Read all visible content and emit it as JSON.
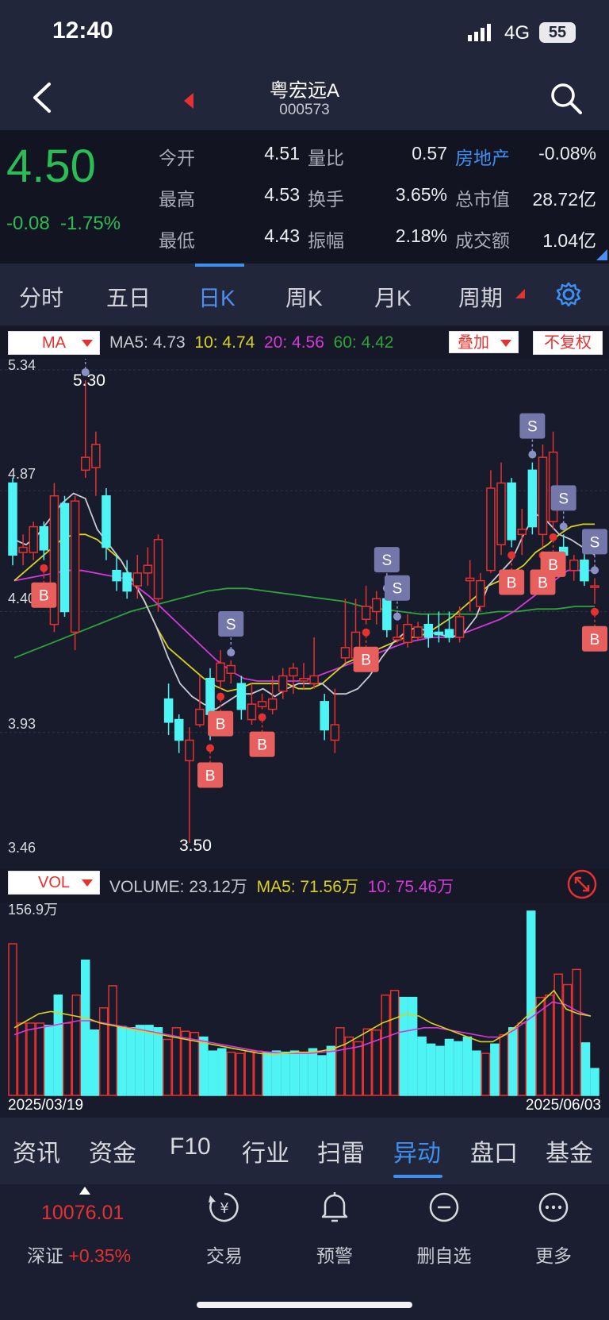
{
  "status": {
    "time": "12:40",
    "network": "4G",
    "battery": "55"
  },
  "header": {
    "title": "粤宏远A",
    "code": "000573"
  },
  "quote": {
    "price": "4.50",
    "change": "-0.08",
    "change_pct": "-1.75%",
    "rows": [
      [
        "今开",
        "4.51",
        "量比",
        "0.57",
        "房地产",
        "-0.08%"
      ],
      [
        "最高",
        "4.53",
        "换手",
        "3.65%",
        "总市值",
        "28.72亿"
      ],
      [
        "最低",
        "4.43",
        "振幅",
        "2.18%",
        "成交额",
        "1.04亿"
      ]
    ]
  },
  "tabs": [
    "分时",
    "五日",
    "日K",
    "周K",
    "月K",
    "周期"
  ],
  "kline": {
    "indicator": "MA",
    "ma_legend": {
      "ma5": "MA5: 4.73",
      "ma10": "10: 4.74",
      "ma20": "20: 4.56",
      "ma60": "60: 4.42"
    },
    "overlay_btn": "叠加",
    "adjust_btn": "不复权",
    "y_labels": [
      "5.34",
      "4.87",
      "4.40",
      "3.93",
      "3.46"
    ],
    "high_label": "5.30",
    "low_label": "3.50",
    "volume_indicator": "VOL",
    "vol_legend": {
      "volume": "VOLUME: 23.12万",
      "ma5": "MA5: 71.56万",
      "ma10": "10: 75.46万"
    },
    "vol_max_label": "156.9万",
    "date_start": "2025/03/19",
    "date_end": "2025/06/03",
    "signal_b": "B",
    "signal_s": "S"
  },
  "bottom_tabs": [
    "资讯",
    "资金",
    "F10",
    "行业",
    "扫雷",
    "异动",
    "盘口",
    "基金"
  ],
  "nav": {
    "index_value": "10076.01",
    "index_name": "深证",
    "index_change": "+0.35%",
    "items": [
      "交易",
      "预警",
      "删自选",
      "更多"
    ]
  },
  "colors": {
    "up": "#e5312f",
    "down": "#4ef4f4",
    "ma5": "#c9c9d2",
    "ma10": "#d7d21f",
    "ma20": "#d43ad8",
    "ma60": "#2fa23a",
    "accent": "#3e8ff0",
    "green": "#2bbd55"
  },
  "chart_data": {
    "type": "candlestick",
    "y_range": [
      3.46,
      5.34
    ],
    "high": 5.3,
    "low": 3.5,
    "candles": [
      {
        "o": 4.9,
        "c": 4.62,
        "h": 4.92,
        "l": 4.58
      },
      {
        "o": 4.63,
        "c": 4.65,
        "h": 4.7,
        "l": 4.58
      },
      {
        "o": 4.63,
        "c": 4.73,
        "h": 4.75,
        "l": 4.6
      },
      {
        "o": 4.73,
        "c": 4.64,
        "h": 4.75,
        "l": 4.6
      },
      {
        "o": 4.35,
        "c": 4.85,
        "h": 4.9,
        "l": 4.32
      },
      {
        "o": 4.82,
        "c": 4.4,
        "h": 4.85,
        "l": 4.38
      },
      {
        "o": 4.32,
        "c": 4.83,
        "h": 4.85,
        "l": 4.25
      },
      {
        "o": 4.95,
        "c": 5.0,
        "h": 5.3,
        "l": 4.92
      },
      {
        "o": 4.96,
        "c": 5.05,
        "h": 5.1,
        "l": 4.85
      },
      {
        "o": 4.85,
        "c": 4.65,
        "h": 4.88,
        "l": 4.6
      },
      {
        "o": 4.56,
        "c": 4.52,
        "h": 4.62,
        "l": 4.48
      },
      {
        "o": 4.55,
        "c": 4.48,
        "h": 4.6,
        "l": 4.45
      },
      {
        "o": 4.5,
        "c": 4.55,
        "h": 4.62,
        "l": 4.45
      },
      {
        "o": 4.55,
        "c": 4.58,
        "h": 4.65,
        "l": 4.5
      },
      {
        "o": 4.45,
        "c": 4.68,
        "h": 4.7,
        "l": 4.4
      },
      {
        "o": 4.06,
        "c": 3.97,
        "h": 4.12,
        "l": 3.92
      },
      {
        "o": 3.98,
        "c": 3.9,
        "h": 4.0,
        "l": 3.85
      },
      {
        "o": 3.82,
        "c": 3.9,
        "h": 3.95,
        "l": 3.5
      },
      {
        "o": 3.96,
        "c": 4.02,
        "h": 4.15,
        "l": 3.95
      },
      {
        "o": 4.14,
        "c": 4.0,
        "h": 4.18,
        "l": 3.9
      },
      {
        "o": 4.13,
        "c": 4.2,
        "h": 4.25,
        "l": 4.1
      },
      {
        "o": 4.16,
        "c": 4.19,
        "h": 4.21,
        "l": 4.12
      },
      {
        "o": 4.12,
        "c": 4.02,
        "h": 4.15,
        "l": 3.98
      },
      {
        "o": 3.98,
        "c": 4.04,
        "h": 4.12,
        "l": 3.96
      },
      {
        "o": 4.03,
        "c": 4.05,
        "h": 4.08,
        "l": 4.02
      },
      {
        "o": 4.02,
        "c": 4.06,
        "h": 4.15,
        "l": 4.0
      },
      {
        "o": 4.09,
        "c": 4.15,
        "h": 4.18,
        "l": 4.06
      },
      {
        "o": 4.15,
        "c": 4.18,
        "h": 4.2,
        "l": 4.08
      },
      {
        "o": 4.13,
        "c": 4.14,
        "h": 4.2,
        "l": 4.1
      },
      {
        "o": 4.12,
        "c": 4.15,
        "h": 4.3,
        "l": 4.1
      },
      {
        "o": 4.05,
        "c": 3.94,
        "h": 4.08,
        "l": 3.9
      },
      {
        "o": 3.9,
        "c": 3.96,
        "h": 4.1,
        "l": 3.85
      },
      {
        "o": 4.22,
        "c": 4.26,
        "h": 4.45,
        "l": 4.2
      },
      {
        "o": 4.22,
        "c": 4.32,
        "h": 4.45,
        "l": 4.2
      },
      {
        "o": 4.37,
        "c": 4.42,
        "h": 4.5,
        "l": 4.35
      },
      {
        "o": 4.4,
        "c": 4.45,
        "h": 4.48,
        "l": 4.35
      },
      {
        "o": 4.45,
        "c": 4.33,
        "h": 4.46,
        "l": 4.3
      },
      {
        "o": 4.29,
        "c": 4.3,
        "h": 4.35,
        "l": 4.28
      },
      {
        "o": 4.28,
        "c": 4.35,
        "h": 4.39,
        "l": 4.26
      },
      {
        "o": 4.3,
        "c": 4.34,
        "h": 4.36,
        "l": 4.29
      },
      {
        "o": 4.35,
        "c": 4.3,
        "h": 4.39,
        "l": 4.26
      },
      {
        "o": 4.32,
        "c": 4.31,
        "h": 4.4,
        "l": 4.28
      },
      {
        "o": 4.33,
        "c": 4.3,
        "h": 4.4,
        "l": 4.28
      },
      {
        "o": 4.3,
        "c": 4.38,
        "h": 4.42,
        "l": 4.28
      },
      {
        "o": 4.52,
        "c": 4.53,
        "h": 4.6,
        "l": 4.4
      },
      {
        "o": 4.42,
        "c": 4.52,
        "h": 4.55,
        "l": 4.4
      },
      {
        "o": 4.56,
        "c": 4.88,
        "h": 4.95,
        "l": 4.55
      },
      {
        "o": 4.66,
        "c": 4.9,
        "h": 4.98,
        "l": 4.62
      },
      {
        "o": 4.9,
        "c": 4.68,
        "h": 4.92,
        "l": 4.65
      },
      {
        "o": 4.7,
        "c": 4.72,
        "h": 4.8,
        "l": 4.62
      },
      {
        "o": 4.95,
        "c": 4.73,
        "h": 4.98,
        "l": 4.7
      },
      {
        "o": 4.7,
        "c": 5.0,
        "h": 5.05,
        "l": 4.65
      },
      {
        "o": 4.75,
        "c": 5.02,
        "h": 5.1,
        "l": 4.72
      },
      {
        "o": 4.65,
        "c": 4.62,
        "h": 4.7,
        "l": 4.58
      },
      {
        "o": 4.56,
        "c": 4.6,
        "h": 4.62,
        "l": 4.52
      },
      {
        "o": 4.6,
        "c": 4.52,
        "h": 4.65,
        "l": 4.5
      },
      {
        "o": 4.5,
        "c": 4.5,
        "h": 4.53,
        "l": 4.43
      }
    ],
    "ma5": [
      4.68,
      4.66,
      4.7,
      4.76,
      4.82,
      4.86,
      4.84,
      4.72,
      4.66,
      4.6,
      4.52,
      4.44,
      4.34,
      4.22,
      4.12,
      4.07,
      4.04,
      4.02,
      4.05,
      4.08,
      4.08,
      4.1,
      4.07,
      4.1,
      4.12,
      4.12,
      4.12,
      4.08,
      4.08,
      4.1,
      4.15,
      4.22,
      4.28,
      4.32,
      4.34,
      4.32,
      4.31,
      4.3,
      4.32,
      4.38,
      4.5,
      4.55,
      4.6,
      4.7,
      4.78,
      4.75,
      4.7,
      4.68,
      4.65,
      4.62
    ],
    "ma10": [
      4.52,
      4.56,
      4.6,
      4.64,
      4.68,
      4.7,
      4.7,
      4.68,
      4.64,
      4.6,
      4.52,
      4.44,
      4.34,
      4.26,
      4.22,
      4.18,
      4.14,
      4.11,
      4.09,
      4.1,
      4.12,
      4.12,
      4.12,
      4.12,
      4.1,
      4.1,
      4.12,
      4.16,
      4.2,
      4.22,
      4.24,
      4.26,
      4.28,
      4.3,
      4.3,
      4.32,
      4.35,
      4.38,
      4.42,
      4.46,
      4.5,
      4.52,
      4.55,
      4.58,
      4.63,
      4.66,
      4.7,
      4.73,
      4.74,
      4.74
    ],
    "ma20": [
      4.52,
      4.53,
      4.54,
      4.55,
      4.56,
      4.56,
      4.55,
      4.54,
      4.53,
      4.5,
      4.46,
      4.41,
      4.36,
      4.31,
      4.26,
      4.21,
      4.17,
      4.14,
      4.13,
      4.13,
      4.13,
      4.13,
      4.14,
      4.16,
      4.18,
      4.2,
      4.22,
      4.24,
      4.26,
      4.28,
      4.29,
      4.3,
      4.3,
      4.31,
      4.33,
      4.35,
      4.37,
      4.4,
      4.44,
      4.48,
      4.52,
      4.56,
      4.56,
      4.56
    ],
    "ma60": [
      4.22,
      4.25,
      4.28,
      4.31,
      4.34,
      4.37,
      4.4,
      4.42,
      4.44,
      4.46,
      4.48,
      4.49,
      4.49,
      4.48,
      4.47,
      4.46,
      4.45,
      4.44,
      4.42,
      4.41,
      4.4,
      4.39,
      4.39,
      4.39,
      4.39,
      4.4,
      4.4,
      4.41,
      4.41,
      4.42,
      4.42
    ],
    "signals": [
      {
        "t": "B",
        "i": 3
      },
      {
        "t": "S",
        "i": 7
      },
      {
        "t": "B",
        "i": 19
      },
      {
        "t": "B",
        "i": 20
      },
      {
        "t": "S",
        "i": 21
      },
      {
        "t": "B",
        "i": 24
      },
      {
        "t": "B",
        "i": 34
      },
      {
        "t": "S",
        "i": 36
      },
      {
        "t": "S",
        "i": 37
      },
      {
        "t": "B",
        "i": 48
      },
      {
        "t": "S",
        "i": 50
      },
      {
        "t": "B",
        "i": 51
      },
      {
        "t": "B",
        "i": 52
      },
      {
        "t": "S",
        "i": 53
      },
      {
        "t": "S",
        "i": 56
      },
      {
        "t": "B",
        "i": 57
      }
    ],
    "volume": [
      130,
      62,
      62,
      62,
      60,
      86,
      62,
      86,
      116,
      56,
      75,
      94,
      59,
      58,
      60,
      60,
      58,
      48,
      58,
      55,
      54,
      50,
      38,
      40,
      37,
      36,
      38,
      38,
      37,
      38,
      37,
      38,
      36,
      40,
      34,
      42,
      58,
      50,
      46,
      57,
      56,
      86,
      90,
      84,
      84,
      50,
      44,
      42,
      48,
      46,
      50,
      38,
      36,
      44,
      52,
      58,
      62,
      158,
      84,
      86,
      104,
      95,
      108,
      45,
      23
    ],
    "vol_up": [
      1,
      1,
      1,
      1,
      0,
      0,
      1,
      1,
      0,
      0,
      1,
      1,
      0,
      0,
      0,
      0,
      0,
      1,
      1,
      1,
      1,
      0,
      0,
      0,
      1,
      1,
      1,
      1,
      0,
      0,
      0,
      0,
      0,
      0,
      0,
      0,
      1,
      1,
      1,
      1,
      1,
      1,
      1,
      0,
      0,
      0,
      0,
      0,
      0,
      0,
      0,
      0,
      1,
      0,
      1,
      0,
      1,
      0,
      1,
      1,
      1,
      1,
      1,
      0,
      0
    ],
    "vol_ma5": [
      58,
      64,
      70,
      72,
      70,
      68,
      66,
      62,
      60,
      58,
      56,
      54,
      52,
      50,
      48,
      46,
      44,
      42,
      40,
      38,
      36,
      35,
      36,
      37,
      37,
      38,
      40,
      44,
      50,
      56,
      62,
      66,
      70,
      68,
      62,
      58,
      54,
      50,
      46,
      46,
      52,
      60,
      70,
      80,
      90,
      74,
      70,
      68
    ],
    "vol_ma10": [
      52,
      56,
      58,
      60,
      62,
      64,
      64,
      62,
      60,
      58,
      56,
      54,
      52,
      50,
      48,
      46,
      44,
      42,
      40,
      38,
      37,
      36,
      36,
      36,
      37,
      38,
      40,
      42,
      46,
      50,
      54,
      56,
      58,
      58,
      56,
      54,
      52,
      50,
      50,
      56,
      64,
      72,
      80,
      78,
      72,
      68
    ]
  }
}
